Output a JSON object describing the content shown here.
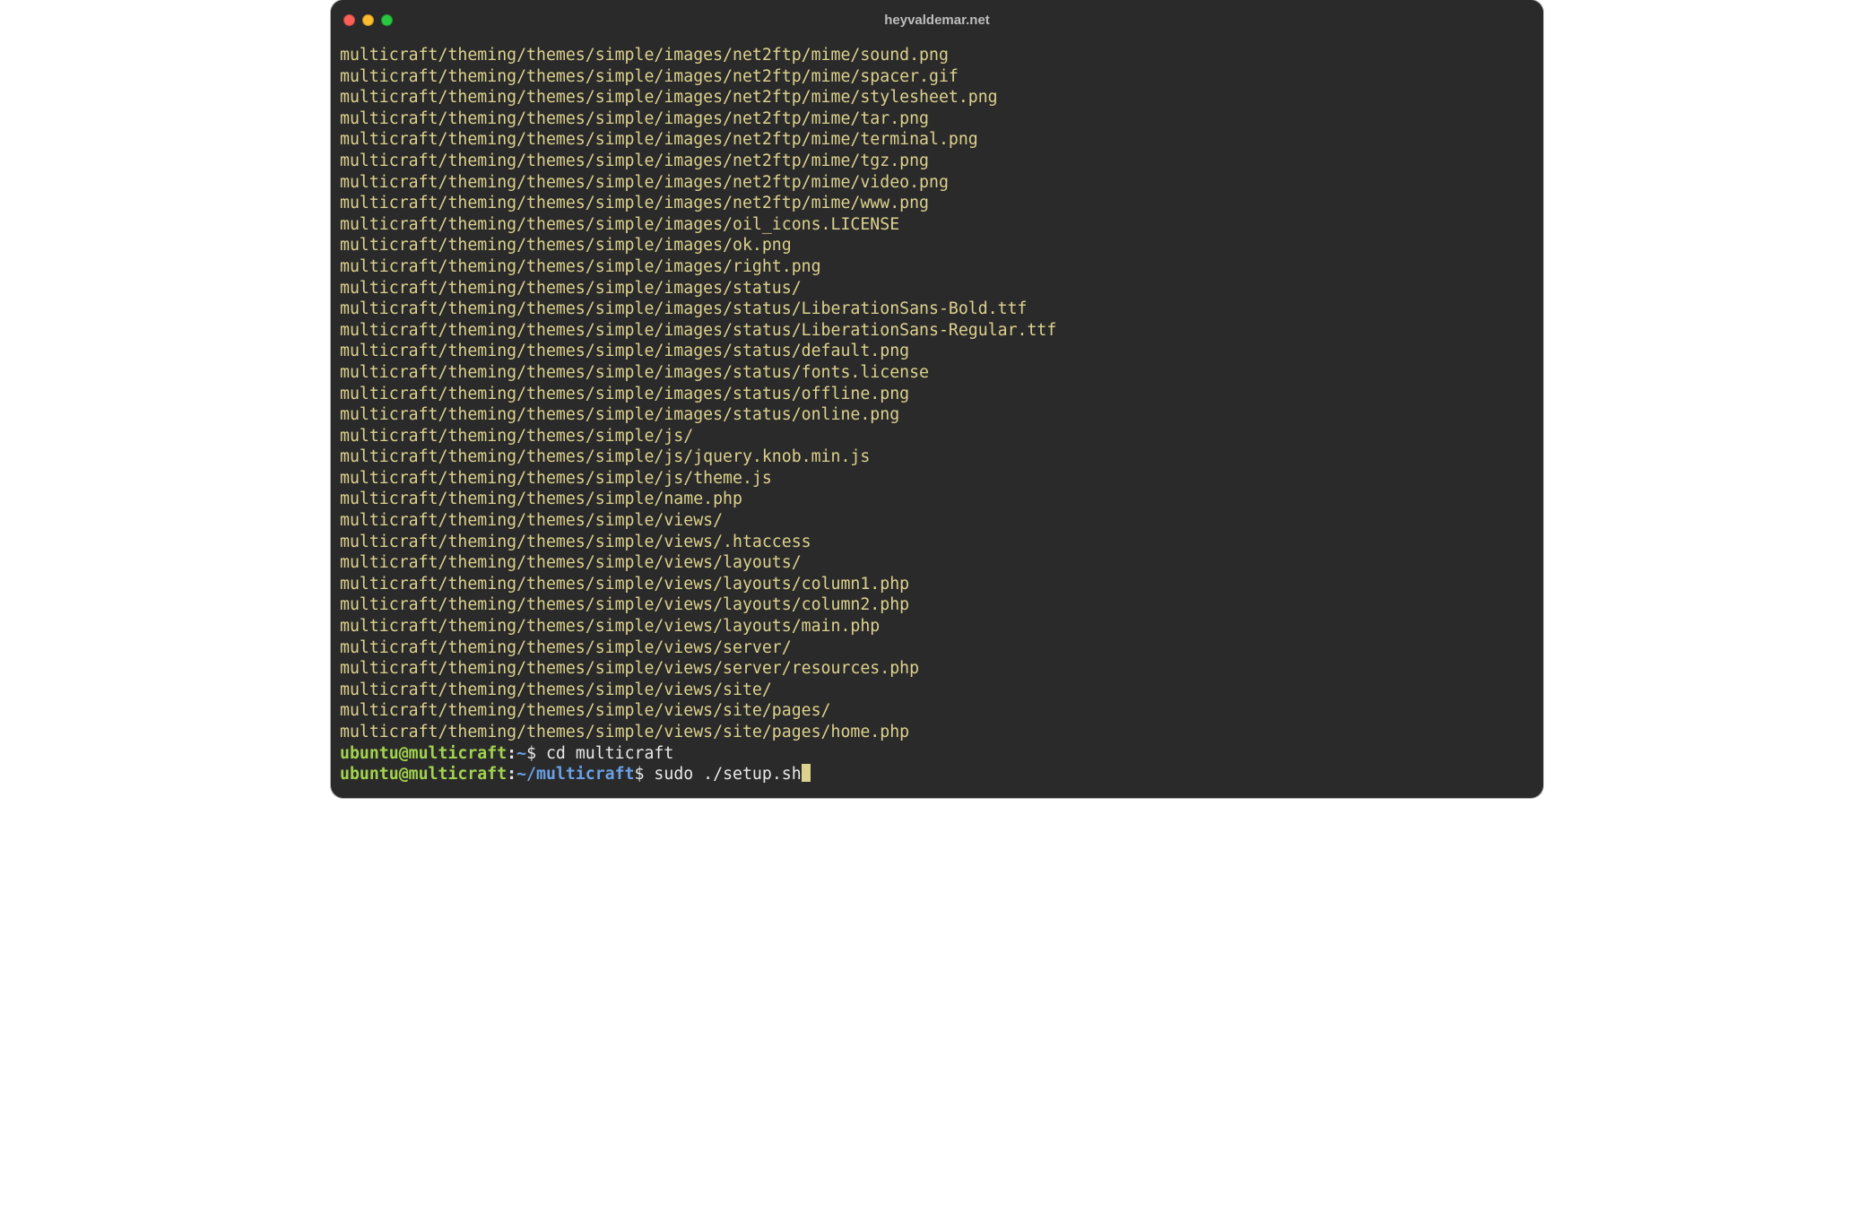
{
  "window": {
    "title": "heyvaldemar.net"
  },
  "colors": {
    "bg": "#2b2a2a",
    "output": "#dcd28e",
    "promptUserHost": "#a2d34e",
    "promptPath": "#6aa0e6",
    "plain": "#e9e9e9"
  },
  "output_lines": [
    "multicraft/theming/themes/simple/images/net2ftp/mime/sound.png",
    "multicraft/theming/themes/simple/images/net2ftp/mime/spacer.gif",
    "multicraft/theming/themes/simple/images/net2ftp/mime/stylesheet.png",
    "multicraft/theming/themes/simple/images/net2ftp/mime/tar.png",
    "multicraft/theming/themes/simple/images/net2ftp/mime/terminal.png",
    "multicraft/theming/themes/simple/images/net2ftp/mime/tgz.png",
    "multicraft/theming/themes/simple/images/net2ftp/mime/video.png",
    "multicraft/theming/themes/simple/images/net2ftp/mime/www.png",
    "multicraft/theming/themes/simple/images/oil_icons.LICENSE",
    "multicraft/theming/themes/simple/images/ok.png",
    "multicraft/theming/themes/simple/images/right.png",
    "multicraft/theming/themes/simple/images/status/",
    "multicraft/theming/themes/simple/images/status/LiberationSans-Bold.ttf",
    "multicraft/theming/themes/simple/images/status/LiberationSans-Regular.ttf",
    "multicraft/theming/themes/simple/images/status/default.png",
    "multicraft/theming/themes/simple/images/status/fonts.license",
    "multicraft/theming/themes/simple/images/status/offline.png",
    "multicraft/theming/themes/simple/images/status/online.png",
    "multicraft/theming/themes/simple/js/",
    "multicraft/theming/themes/simple/js/jquery.knob.min.js",
    "multicraft/theming/themes/simple/js/theme.js",
    "multicraft/theming/themes/simple/name.php",
    "multicraft/theming/themes/simple/views/",
    "multicraft/theming/themes/simple/views/.htaccess",
    "multicraft/theming/themes/simple/views/layouts/",
    "multicraft/theming/themes/simple/views/layouts/column1.php",
    "multicraft/theming/themes/simple/views/layouts/column2.php",
    "multicraft/theming/themes/simple/views/layouts/main.php",
    "multicraft/theming/themes/simple/views/server/",
    "multicraft/theming/themes/simple/views/server/resources.php",
    "multicraft/theming/themes/simple/views/site/",
    "multicraft/theming/themes/simple/views/site/pages/",
    "multicraft/theming/themes/simple/views/site/pages/home.php"
  ],
  "prompts": [
    {
      "user": "ubuntu",
      "at": "@",
      "host": "multicraft",
      "colon": ":",
      "path": "~",
      "dollar": "$ ",
      "command": "cd multicraft",
      "cursor": false
    },
    {
      "user": "ubuntu",
      "at": "@",
      "host": "multicraft",
      "colon": ":",
      "path": "~/multicraft",
      "dollar": "$ ",
      "command": "sudo ./setup.sh",
      "cursor": true
    }
  ]
}
